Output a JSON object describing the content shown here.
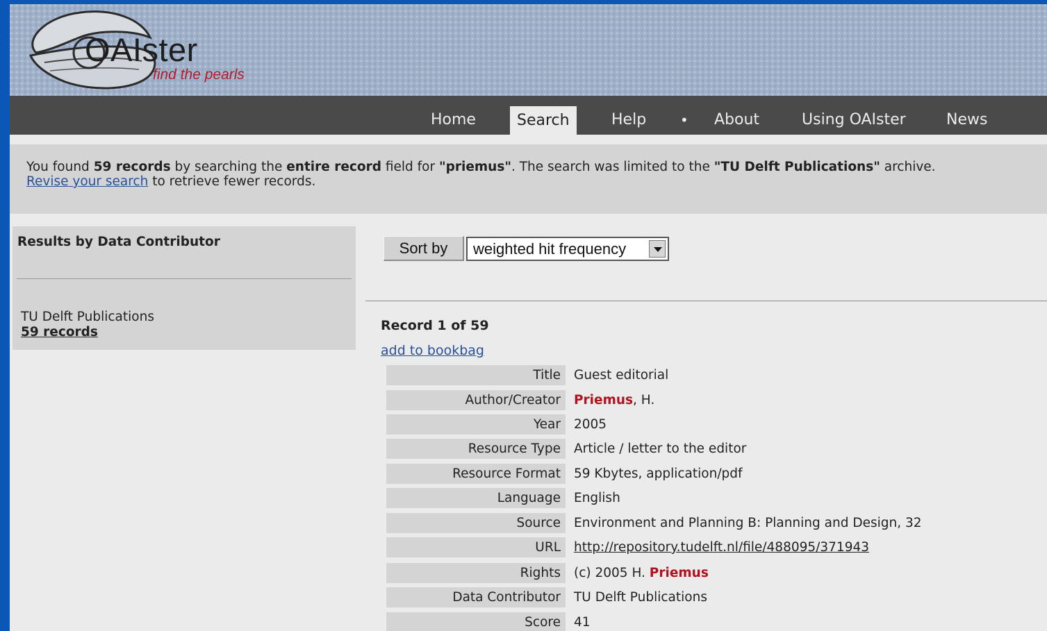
{
  "header": {
    "logo_text": "OAIster",
    "tagline": "find the pearls"
  },
  "nav": {
    "items": [
      {
        "label": "Home"
      },
      {
        "label": "Search",
        "active": true
      },
      {
        "label": "Help"
      },
      {
        "label": "About"
      },
      {
        "label": "Using OAIster"
      },
      {
        "label": "News"
      }
    ],
    "separator": "•"
  },
  "summary": {
    "t1": "You found ",
    "count": "59 records",
    "t2": " by searching the ",
    "field": "entire record",
    "t3": " field for ",
    "query": "\"priemus\"",
    "t4": ".  The search was limited to the ",
    "archive": "\"TU Delft Publications\"",
    "t5": " archive.",
    "revise_link": "Revise your search",
    "t6": " to retrieve fewer records."
  },
  "sidebar": {
    "heading": "Results by Data Contributor",
    "contributor": "TU Delft Publications",
    "contributor_count": "59 records"
  },
  "sort": {
    "button_label": "Sort by",
    "selected": "weighted hit frequency"
  },
  "record": {
    "heading": "Record 1 of 59",
    "bookbag_link": "add to bookbag",
    "fields": {
      "title_label": "Title",
      "title": "Guest editorial",
      "author_label": "Author/Creator",
      "author_hl": "Priemus",
      "author_rest": ", H.",
      "year_label": "Year",
      "year": "2005",
      "type_label": "Resource Type",
      "type": "Article / letter to the editor",
      "format_label": "Resource Format",
      "format": "59 Kbytes, application/pdf",
      "language_label": "Language",
      "language": "English",
      "source_label": "Source",
      "source": "Environment and Planning B: Planning and Design, 32",
      "url_label": "URL",
      "url": "http://repository.tudelft.nl/file/488095/371943",
      "rights_label": "Rights",
      "rights_pre": "(c) 2005 H. ",
      "rights_hl": "Priemus",
      "contributor_label": "Data Contributor",
      "contributor": "TU Delft Publications",
      "score_label": "Score",
      "score": "41"
    }
  },
  "colors": {
    "frame_border": "#0a57b8",
    "nav_bg": "#4a4a4a",
    "highlight": "#b0121f",
    "link": "#2a4f9a"
  }
}
